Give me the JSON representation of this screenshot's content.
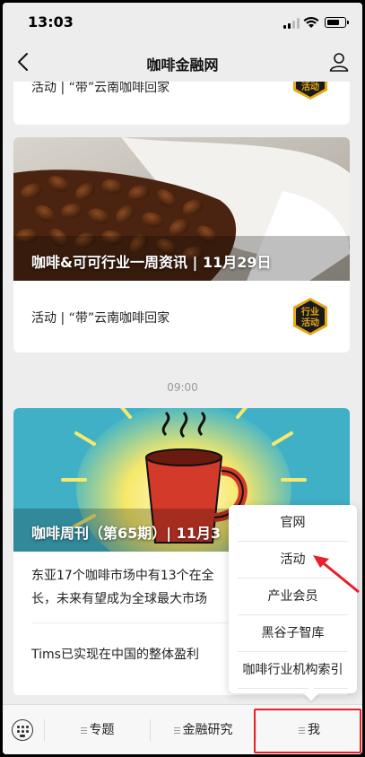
{
  "status_bar": {
    "time": "13:03"
  },
  "nav": {
    "title": "咖啡金融网"
  },
  "articles": [
    {
      "text": "活动 | “带”云南咖啡回家",
      "badge": [
        "行业",
        "活动"
      ]
    },
    {
      "hero_caption": "咖啡&可可行业一周资讯 | 11月29日",
      "text": "活动 | “带”云南咖啡回家",
      "badge": [
        "行业",
        "活动"
      ]
    }
  ],
  "timestamp": "09:00",
  "weekly": {
    "hero_caption": "咖啡周刊（第65期）| 11月3",
    "items": [
      {
        "text": "东亚17个咖啡市场中有13个在全\n长，未来有望成为全球最大市场"
      },
      {
        "text": "Tims已实现在中国的整体盈利"
      }
    ]
  },
  "popup_menu": {
    "items": [
      "官网",
      "活动",
      "产业会员",
      "黑谷子智库",
      "咖啡行业机构索引"
    ]
  },
  "tabbar": {
    "tabs": [
      "专题",
      "金融研究",
      "我"
    ]
  },
  "colors": {
    "accent": "#e8202a",
    "badge_bg": "#1a1a1a",
    "badge_ring": "#e6a817"
  }
}
